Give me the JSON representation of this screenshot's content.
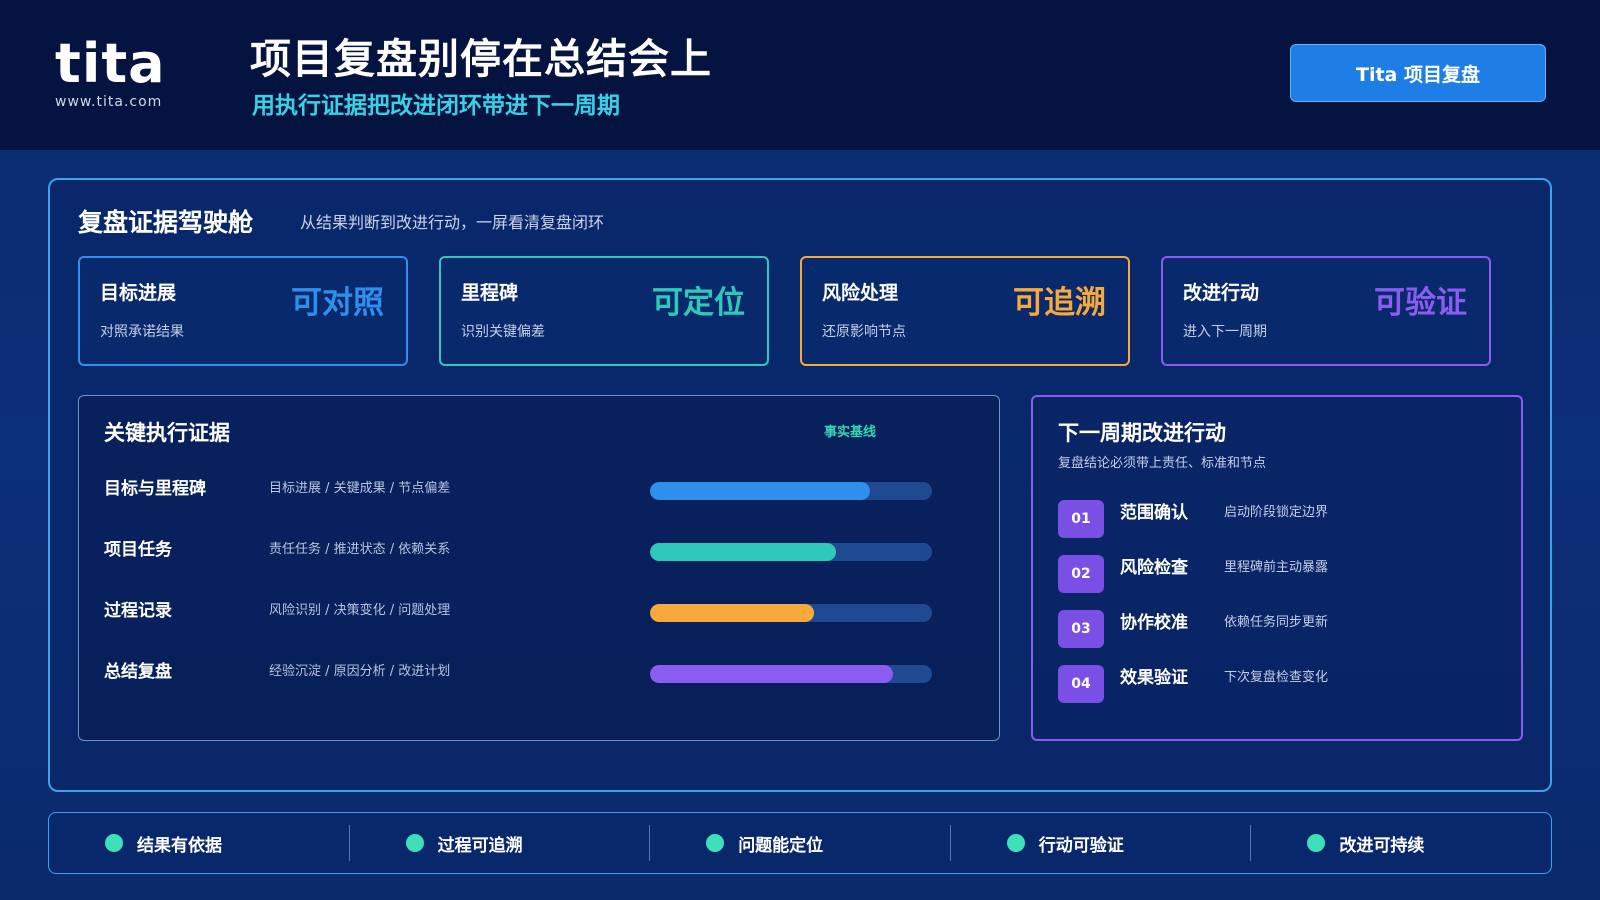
{
  "header": {
    "logo_text": "tita",
    "logo_url": "www.tita.com",
    "title": "项目复盘别停在总结会上",
    "subtitle": "用执行证据把改进闭环带进下一周期",
    "cta_label": "Tita 项目复盘"
  },
  "panel": {
    "title": "复盘证据驾驶舱",
    "description": "从结果判断到改进行动，一屏看清复盘闭环"
  },
  "cards": [
    {
      "label": "目标进展",
      "description": "对照承诺结果",
      "big": "可对照",
      "color": "#2f8fee"
    },
    {
      "label": "里程碑",
      "description": "识别关键偏差",
      "big": "可定位",
      "color": "#2ec9bb"
    },
    {
      "label": "风险处理",
      "description": "还原影响节点",
      "big": "可追溯",
      "color": "#f7aa3b"
    },
    {
      "label": "改进行动",
      "description": "进入下一周期",
      "big": "可验证",
      "color": "#8a5cf0"
    }
  ],
  "evidence": {
    "title": "关键执行证据",
    "badge": "事实基线",
    "rows": [
      {
        "label": "目标与里程碑",
        "description": "目标进展 / 关键成果 / 节点偏差",
        "progress": 0.78,
        "color": "#2f8fee"
      },
      {
        "label": "项目任务",
        "description": "责任任务 / 推进状态 / 依赖关系",
        "progress": 0.66,
        "color": "#2ec9bb"
      },
      {
        "label": "过程记录",
        "description": "风险识别 / 决策变化 / 问题处理",
        "progress": 0.58,
        "color": "#f7aa3b"
      },
      {
        "label": "总结复盘",
        "description": "经验沉淀 / 原因分析 / 改进计划",
        "progress": 0.86,
        "color": "#8a5cf0"
      }
    ]
  },
  "actions": {
    "title": "下一周期改进行动",
    "subtitle": "复盘结论必须带上责任、标准和节点",
    "items": [
      {
        "num": "01",
        "label": "范围确认",
        "description": "启动阶段锁定边界"
      },
      {
        "num": "02",
        "label": "风险检查",
        "description": "里程碑前主动暴露"
      },
      {
        "num": "03",
        "label": "协作校准",
        "description": "依赖任务同步更新"
      },
      {
        "num": "04",
        "label": "效果验证",
        "description": "下次复盘检查变化"
      }
    ]
  },
  "footer": {
    "items": [
      "结果有依据",
      "过程可追溯",
      "问题能定位",
      "行动可验证",
      "改进可持续"
    ]
  }
}
